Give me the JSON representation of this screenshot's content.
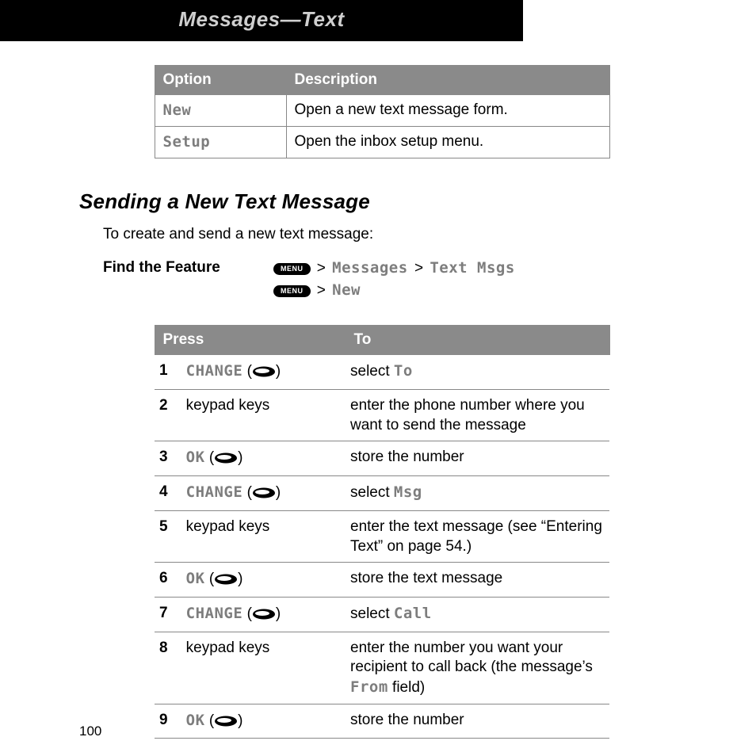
{
  "header": {
    "title": "Messages—Text"
  },
  "options_table": {
    "head": {
      "option": "Option",
      "description": "Description"
    },
    "rows": [
      {
        "name": "New",
        "desc": "Open a new text message form."
      },
      {
        "name": "Setup",
        "desc": "Open the inbox setup menu."
      }
    ]
  },
  "section_heading": "Sending a New Text Message",
  "intro_text": "To create and send a new text message:",
  "feature": {
    "label": "Find the Feature",
    "menu_key_label": "MENU",
    "path1": {
      "a": "Messages",
      "b": "Text Msgs"
    },
    "path2": {
      "a": "New"
    }
  },
  "steps_table": {
    "head": {
      "press": "Press",
      "to": "To"
    },
    "rows": [
      {
        "num": "1",
        "soft": "CHANGE",
        "press_plain": "",
        "to_pre": "select ",
        "to_term": "To",
        "to_post": ""
      },
      {
        "num": "2",
        "soft": "",
        "press_plain": "keypad keys",
        "to_pre": "enter the phone number where you want to send the message",
        "to_term": "",
        "to_post": ""
      },
      {
        "num": "3",
        "soft": "OK",
        "press_plain": "",
        "to_pre": "store the number",
        "to_term": "",
        "to_post": ""
      },
      {
        "num": "4",
        "soft": "CHANGE",
        "press_plain": "",
        "to_pre": "select ",
        "to_term": "Msg",
        "to_post": ""
      },
      {
        "num": "5",
        "soft": "",
        "press_plain": "keypad keys",
        "to_pre": "enter the text message (see “Entering Text” on page 54.)",
        "to_term": "",
        "to_post": ""
      },
      {
        "num": "6",
        "soft": "OK",
        "press_plain": "",
        "to_pre": "store the text message",
        "to_term": "",
        "to_post": ""
      },
      {
        "num": "7",
        "soft": "CHANGE",
        "press_plain": "",
        "to_pre": "select ",
        "to_term": "Call",
        "to_post": ""
      },
      {
        "num": "8",
        "soft": "",
        "press_plain": "keypad keys",
        "to_pre": "enter the number you want your recipient to call back (the message’s ",
        "to_term": "From",
        "to_post": " field)"
      },
      {
        "num": "9",
        "soft": "OK",
        "press_plain": "",
        "to_pre": "store the number",
        "to_term": "",
        "to_post": ""
      }
    ]
  },
  "page_number": "100"
}
